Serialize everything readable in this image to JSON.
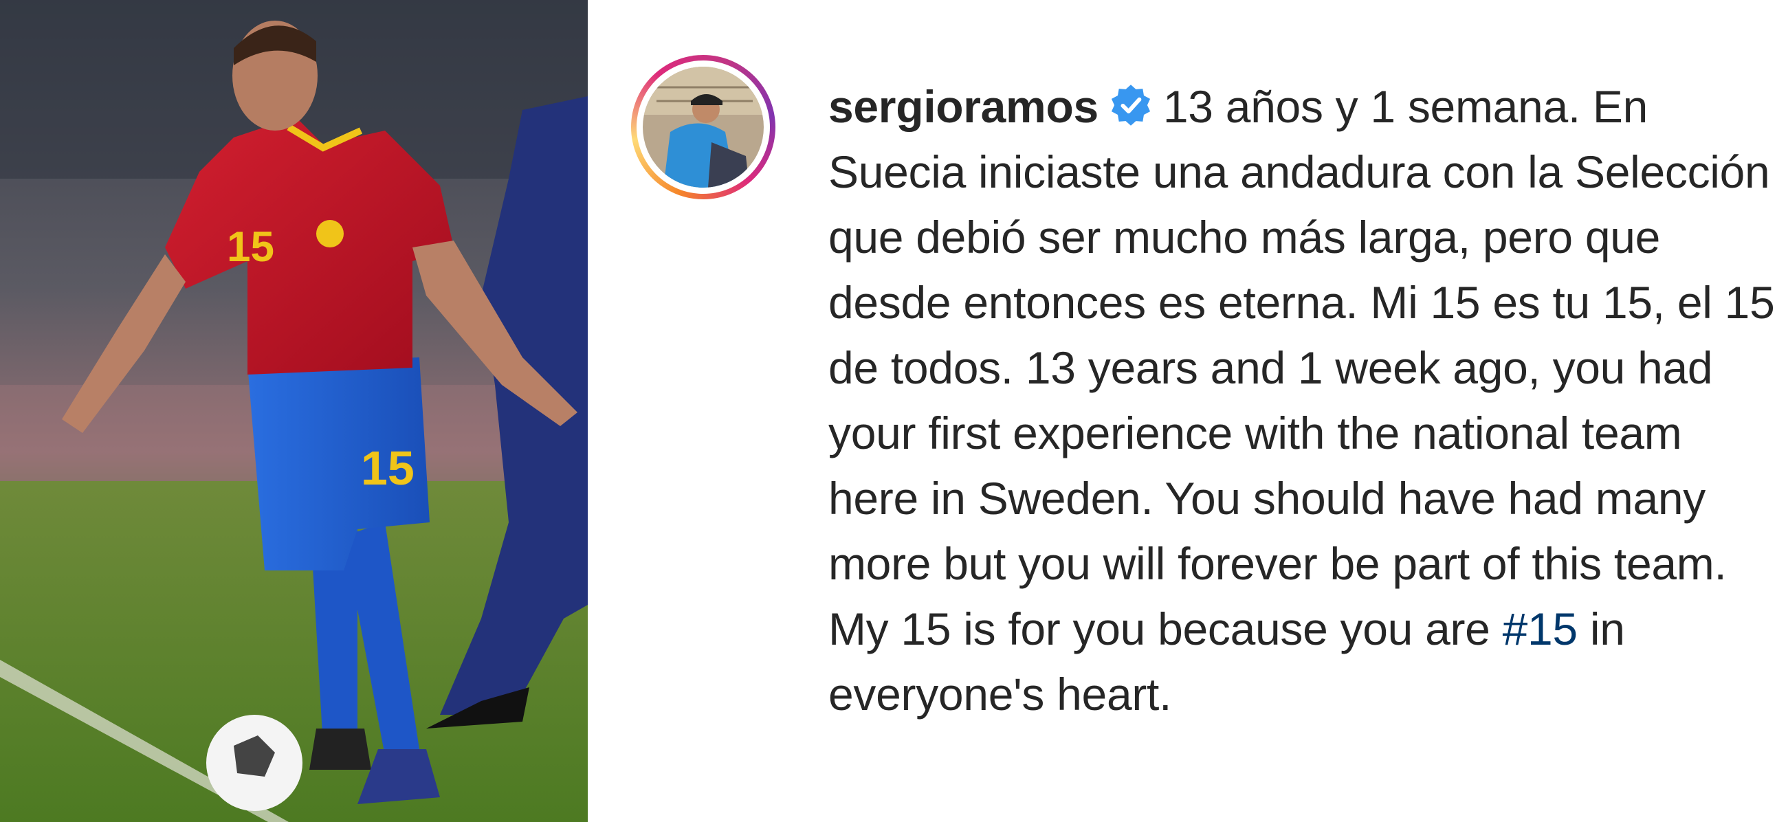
{
  "post": {
    "username": "sergioramos",
    "verified_icon": "verified-badge-icon",
    "caption_es": "13 años y 1 semana. En Suecia iniciaste una andadura con la Selección que debió ser mucho más larga, pero que desde entonces es eterna.  Mi 15 es tu 15, el 15 de todos.",
    "caption_en_before_tag": "13 years and 1 week ago, you had your first experience with the national team here in Sweden. You should have had many more but you will forever be part of this team. My 15 is for you because you are ",
    "hashtag": "#15",
    "caption_en_after_tag": " in everyone's heart.",
    "jersey_number": "15"
  },
  "colors": {
    "text": "#262626",
    "hashtag": "#00376b",
    "verified": "#3897f0",
    "jersey_red": "#c8102e",
    "shorts_blue": "#1f5fd0"
  }
}
